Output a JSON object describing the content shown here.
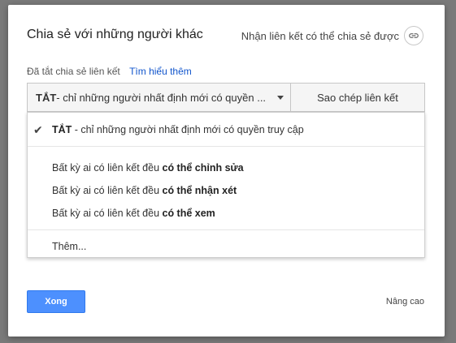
{
  "dialog": {
    "title": "Chia sẻ với những người khác",
    "share_link_label": "Nhận liên kết có thể chia sẻ được",
    "link_icon": "link-icon"
  },
  "link_status": {
    "text": "Đã tắt chia sẻ liên kết",
    "learn_more": "Tìm hiểu thêm"
  },
  "access_select": {
    "selected_bold": "TẮT",
    "selected_rest": " - chỉ những người nhất định mới có quyền ..."
  },
  "copy_link_label": "Sao chép liên kết",
  "menu": {
    "items": [
      {
        "prefix": "TẮT",
        "text": " - chỉ những người nhất định mới có quyền truy cập",
        "checked": true
      },
      {
        "text": "Bất kỳ ai có liên kết đều ",
        "bold": "có thể chỉnh sửa"
      },
      {
        "text": "Bất kỳ ai có liên kết đều ",
        "bold": "có thể nhận xét"
      },
      {
        "text": "Bất kỳ ai có liên kết đều ",
        "bold": "có thể xem"
      },
      {
        "text": "Thêm..."
      }
    ]
  },
  "footer": {
    "done_label": "Xong",
    "advanced_label": "Nâng cao"
  },
  "colors": {
    "primary_button": "#4d90fe",
    "link": "#1155cc"
  }
}
